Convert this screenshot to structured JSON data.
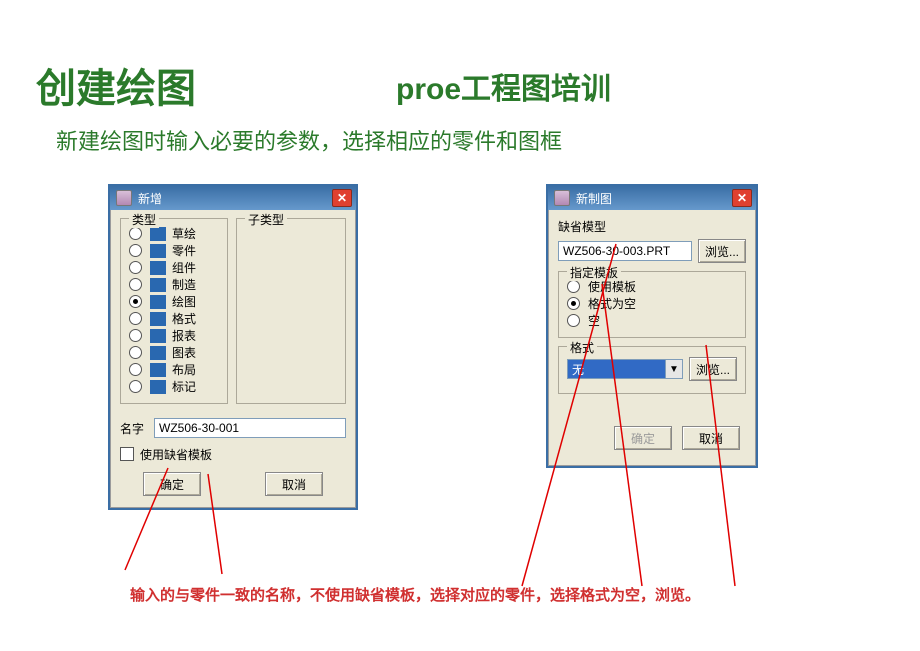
{
  "page": {
    "title": "创建绘图",
    "subtitle": "proe工程图培训",
    "instruction": "新建绘图时输入必要的参数，选择相应的零件和图框",
    "caption": "输入的与零件一致的名称，不使用缺省模板，选择对应的零件，选择格式为空，浏览。"
  },
  "dialog_new": {
    "title": "新增",
    "close_x": "✕",
    "group_type_label": "类型",
    "group_subtype_label": "子类型",
    "types": [
      {
        "label": "草绘",
        "checked": false
      },
      {
        "label": "零件",
        "checked": false
      },
      {
        "label": "组件",
        "checked": false
      },
      {
        "label": "制造",
        "checked": false
      },
      {
        "label": "绘图",
        "checked": true
      },
      {
        "label": "格式",
        "checked": false
      },
      {
        "label": "报表",
        "checked": false
      },
      {
        "label": "图表",
        "checked": false
      },
      {
        "label": "布局",
        "checked": false
      },
      {
        "label": "标记",
        "checked": false
      }
    ],
    "name_label": "名字",
    "name_value": "WZ506-30-001",
    "use_default_template": "使用缺省模板",
    "ok": "确定",
    "cancel": "取消"
  },
  "dialog_draw": {
    "title": "新制图",
    "close_x": "✕",
    "default_model_label": "缺省模型",
    "default_model_value": "WZ506-30-003.PRT",
    "browse": "浏览...",
    "template_group": "指定模板",
    "template_options": [
      {
        "label": "使用模板",
        "checked": false
      },
      {
        "label": "格式为空",
        "checked": true
      },
      {
        "label": "空",
        "checked": false
      }
    ],
    "format_group": "格式",
    "format_value": "无",
    "browse2": "浏览...",
    "ok": "确定",
    "cancel": "取消"
  }
}
